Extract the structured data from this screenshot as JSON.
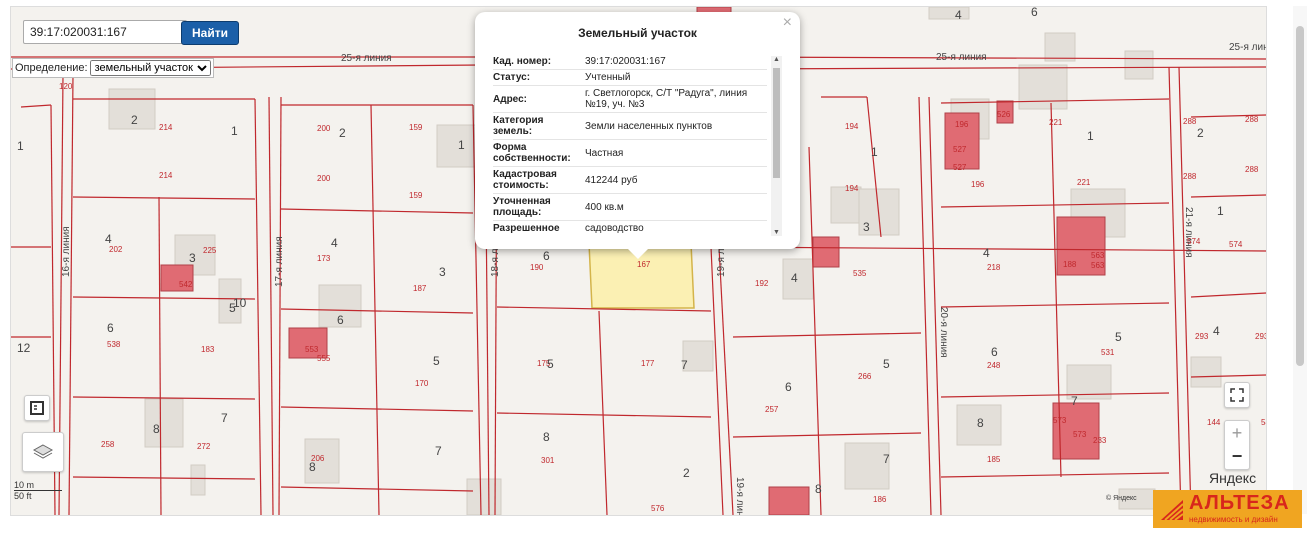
{
  "search": {
    "value": "39:17:020031:167",
    "button_label": "Найти"
  },
  "definition": {
    "label": "Определение:",
    "selected": "земельный участок"
  },
  "scale": {
    "metric": "10 m",
    "imperial": "50 ft"
  },
  "map_labels": [
    {
      "t": "25-я линия",
      "c": "g"
    },
    {
      "t": "25-я линия",
      "c": "g"
    },
    {
      "t": "25-я линия",
      "c": "g"
    },
    {
      "t": "25-я линия",
      "c": "g"
    },
    {
      "t": "16-я линия",
      "c": "g"
    },
    {
      "t": "17-я линия",
      "c": "g"
    },
    {
      "t": "18-я линия",
      "c": "g"
    },
    {
      "t": "19-я линия",
      "c": "g"
    },
    {
      "t": "19-я линия",
      "c": "g"
    },
    {
      "t": "20-я линия",
      "c": "g"
    },
    {
      "t": "21-я линия",
      "c": "g"
    },
    {
      "t": "120",
      "c": "r"
    },
    {
      "t": "214",
      "c": "r"
    },
    {
      "t": "214",
      "c": "r"
    },
    {
      "t": "202",
      "c": "r"
    },
    {
      "t": "225",
      "c": "r"
    },
    {
      "t": "542",
      "c": "r"
    },
    {
      "t": "538",
      "c": "r"
    },
    {
      "t": "183",
      "c": "r"
    },
    {
      "t": "258",
      "c": "r"
    },
    {
      "t": "272",
      "c": "r"
    },
    {
      "t": "200",
      "c": "r"
    },
    {
      "t": "200",
      "c": "r"
    },
    {
      "t": "159",
      "c": "r"
    },
    {
      "t": "159",
      "c": "r"
    },
    {
      "t": "173",
      "c": "r"
    },
    {
      "t": "187",
      "c": "r"
    },
    {
      "t": "553",
      "c": "r"
    },
    {
      "t": "555",
      "c": "r"
    },
    {
      "t": "170",
      "c": "r"
    },
    {
      "t": "206",
      "c": "r"
    },
    {
      "t": "190",
      "c": "r"
    },
    {
      "t": "167",
      "c": "r"
    },
    {
      "t": "175",
      "c": "r"
    },
    {
      "t": "177",
      "c": "r"
    },
    {
      "t": "301",
      "c": "r"
    },
    {
      "t": "576",
      "c": "r"
    },
    {
      "t": "192",
      "c": "r"
    },
    {
      "t": "535",
      "c": "r"
    },
    {
      "t": "266",
      "c": "r"
    },
    {
      "t": "257",
      "c": "r"
    },
    {
      "t": "186",
      "c": "r"
    },
    {
      "t": "194",
      "c": "r"
    },
    {
      "t": "194",
      "c": "r"
    },
    {
      "t": "196",
      "c": "r"
    },
    {
      "t": "196",
      "c": "r"
    },
    {
      "t": "527",
      "c": "r"
    },
    {
      "t": "527",
      "c": "r"
    },
    {
      "t": "526",
      "c": "r"
    },
    {
      "t": "221",
      "c": "r"
    },
    {
      "t": "221",
      "c": "r"
    },
    {
      "t": "218",
      "c": "r"
    },
    {
      "t": "188",
      "c": "r"
    },
    {
      "t": "563",
      "c": "r"
    },
    {
      "t": "563",
      "c": "r"
    },
    {
      "t": "248",
      "c": "r"
    },
    {
      "t": "531",
      "c": "r"
    },
    {
      "t": "185",
      "c": "r"
    },
    {
      "t": "573",
      "c": "r"
    },
    {
      "t": "573",
      "c": "r"
    },
    {
      "t": "233",
      "c": "r"
    },
    {
      "t": "288",
      "c": "r"
    },
    {
      "t": "288",
      "c": "r"
    },
    {
      "t": "288",
      "c": "r"
    },
    {
      "t": "288",
      "c": "r"
    },
    {
      "t": "574",
      "c": "r"
    },
    {
      "t": "574",
      "c": "r"
    },
    {
      "t": "293",
      "c": "r"
    },
    {
      "t": "293",
      "c": "r"
    },
    {
      "t": "144",
      "c": "r"
    },
    {
      "t": "544",
      "c": "r"
    },
    {
      "t": "2",
      "c": "d"
    },
    {
      "t": "1",
      "c": "d"
    },
    {
      "t": "4",
      "c": "d"
    },
    {
      "t": "3",
      "c": "d"
    },
    {
      "t": "5",
      "c": "d"
    },
    {
      "t": "6",
      "c": "d"
    },
    {
      "t": "8",
      "c": "d"
    },
    {
      "t": "7",
      "c": "d"
    },
    {
      "t": "1",
      "c": "d"
    },
    {
      "t": "2",
      "c": "d"
    },
    {
      "t": "4",
      "c": "d"
    },
    {
      "t": "3",
      "c": "d"
    },
    {
      "t": "6",
      "c": "d"
    },
    {
      "t": "5",
      "c": "d"
    },
    {
      "t": "8",
      "c": "d"
    },
    {
      "t": "7",
      "c": "d"
    },
    {
      "t": "1",
      "c": "d"
    },
    {
      "t": "4",
      "c": "d"
    },
    {
      "t": "6",
      "c": "d"
    },
    {
      "t": "5",
      "c": "d"
    },
    {
      "t": "8",
      "c": "d"
    },
    {
      "t": "7",
      "c": "d"
    },
    {
      "t": "1",
      "c": "d"
    },
    {
      "t": "3",
      "c": "d"
    },
    {
      "t": "4",
      "c": "d"
    },
    {
      "t": "6",
      "c": "d"
    },
    {
      "t": "5",
      "c": "d"
    },
    {
      "t": "8",
      "c": "d"
    },
    {
      "t": "7",
      "c": "d"
    },
    {
      "t": "2",
      "c": "d"
    },
    {
      "t": "1",
      "c": "d"
    },
    {
      "t": "4",
      "c": "d"
    },
    {
      "t": "6",
      "c": "d"
    },
    {
      "t": "5",
      "c": "d"
    },
    {
      "t": "7",
      "c": "d"
    },
    {
      "t": "8",
      "c": "d"
    },
    {
      "t": "2",
      "c": "d"
    },
    {
      "t": "4",
      "c": "d"
    },
    {
      "t": "6",
      "c": "d"
    },
    {
      "t": "3",
      "c": "d"
    },
    {
      "t": "10",
      "c": "d"
    },
    {
      "t": "12",
      "c": "d"
    },
    {
      "t": "1",
      "c": "d"
    },
    {
      "t": "5",
      "c": "d"
    },
    {
      "t": "5",
      "c": "d"
    },
    {
      "t": "6",
      "c": "d"
    },
    {
      "t": "4",
      "c": "d"
    }
  ],
  "popup": {
    "title": "Земельный участок",
    "close": "×",
    "rows": [
      {
        "k": "Кад. номер:",
        "v": "39:17:020031:167"
      },
      {
        "k": "Статус:",
        "v": "Учтенный"
      },
      {
        "k": "Адрес:",
        "v": "г. Светлогорск, С/Т \"Радуга\", линия №19, уч. №3"
      },
      {
        "k": "Категория земель:",
        "v": "Земли населенных пунктов"
      },
      {
        "k": "Форма собственности:",
        "v": "Частная"
      },
      {
        "k": "Кадастровая стоимость:",
        "v": "412244 руб"
      },
      {
        "k": "Уточненная площадь:",
        "v": "400 кв.м"
      },
      {
        "k": "Разрешенное",
        "v": "садоводство"
      }
    ]
  },
  "controls": {
    "fullscreen_icon": "fullscreen-icon",
    "zoom_in": "+",
    "zoom_out": "−",
    "ruler_icon": "ruler-icon",
    "layers_icon": "layers-icon"
  },
  "brand": {
    "yandex": "Яндекс",
    "copyright": "© Яндекс",
    "logo_main": "АЛЬТЕЗА",
    "logo_sub": "недвижимость и дизайн"
  },
  "colors": {
    "boundary": "#c0282d",
    "selected_fill": "#fbf0b3",
    "selected_stroke": "#d4b44a",
    "building": "#e3dfd9",
    "red_building": "#e06b73"
  }
}
